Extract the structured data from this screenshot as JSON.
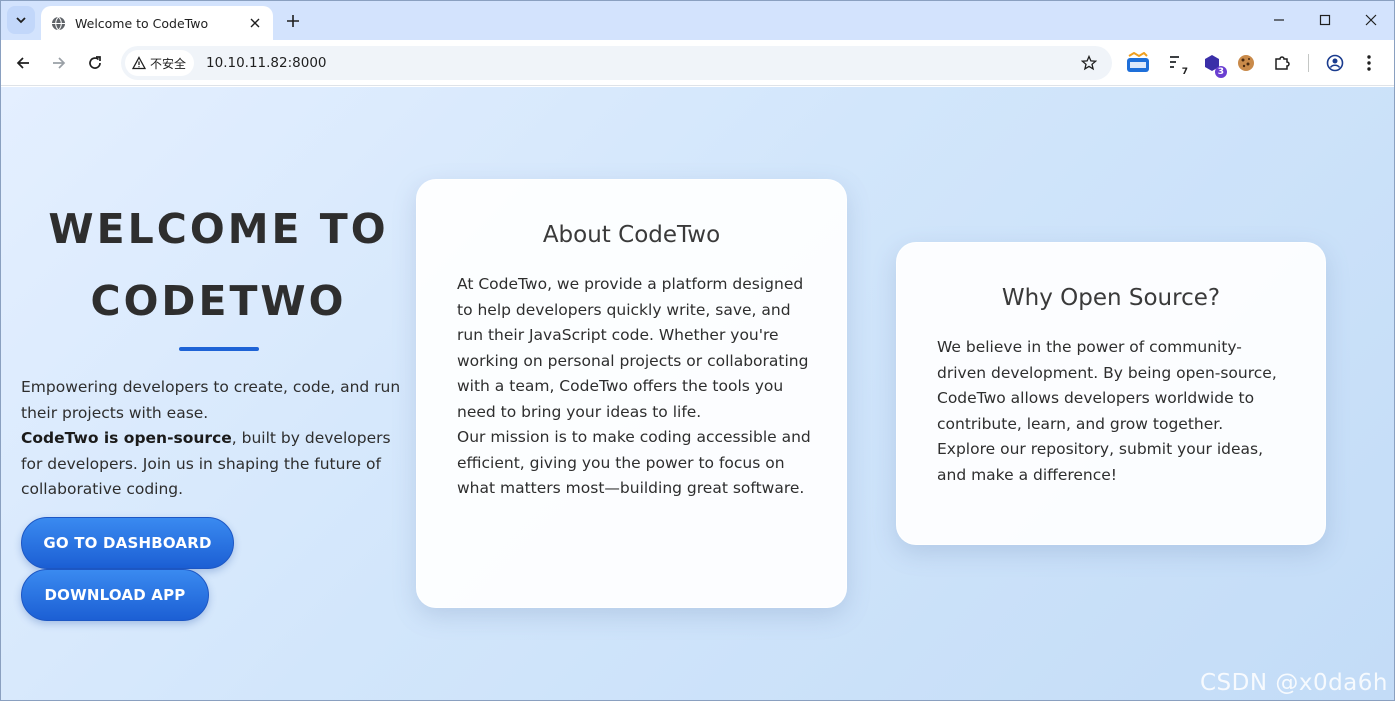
{
  "browser": {
    "tab_title": "Welcome to CodeTwo",
    "security_label": "不安全",
    "url": "10.10.11.82:8000",
    "extensions": [
      {
        "icon": "translate-extension-icon",
        "badge": ""
      },
      {
        "icon": "script-extension-icon",
        "badge": "7"
      },
      {
        "icon": "cube-extension-icon",
        "badge": "3"
      },
      {
        "icon": "cookie-extension-icon",
        "badge": ""
      }
    ]
  },
  "hero": {
    "title_line1": "WELCOME TO",
    "title_line2": "CODETWO",
    "text_1": "Empowering developers to create, code, and run their projects with ease.",
    "text_bold": "CodeTwo is open-source",
    "text_2": ", built by developers for developers. Join us in shaping the future of collaborative coding.",
    "dashboard_button": "GO TO DASHBOARD",
    "download_button": "DOWNLOAD APP"
  },
  "about": {
    "title": "About CodeTwo",
    "para_1": "At CodeTwo, we provide a platform designed to help developers quickly write, save, and run their JavaScript code. Whether you're working on personal projects or collaborating with a team, CodeTwo offers the tools you need to bring your ideas to life.",
    "para_2": "Our mission is to make coding accessible and efficient, giving you the power to focus on what matters most—building great software."
  },
  "why": {
    "title": "Why Open Source?",
    "para": "We believe in the power of community-driven development. By being open-source, CodeTwo allows developers worldwide to contribute, learn, and grow together. Explore our repository, submit your ideas, and make a difference!"
  },
  "watermark": "CSDN @x0da6h",
  "colors": {
    "accent": "#1e63d6",
    "button_top": "#3a8af0",
    "button_bottom": "#1c5fd4",
    "tabbar": "#d3e3fd",
    "page_bg": "#d2e6fb"
  }
}
